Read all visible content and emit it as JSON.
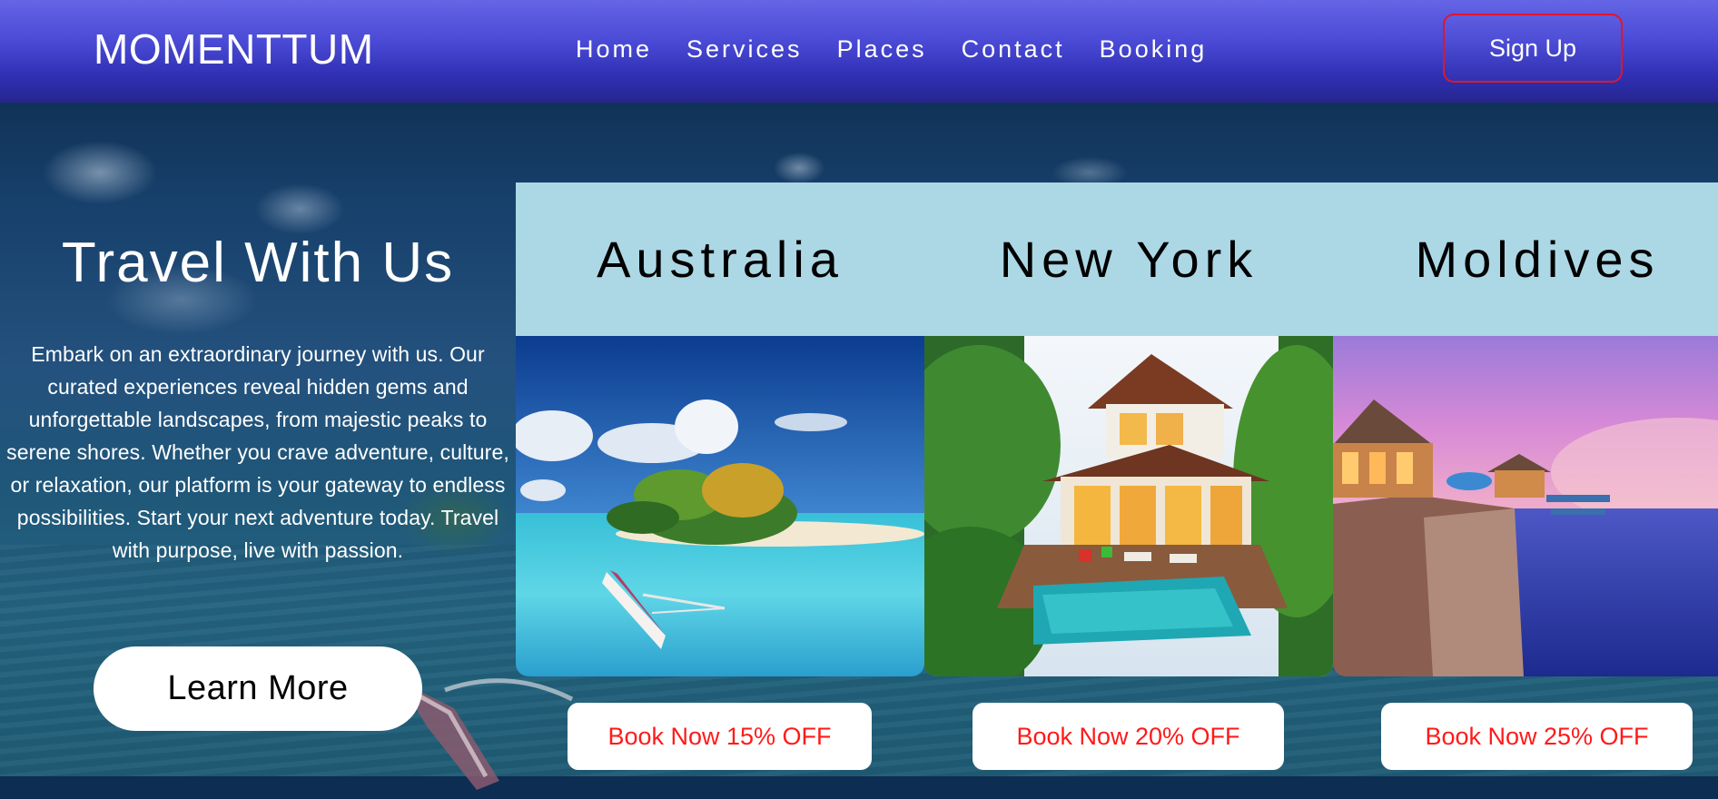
{
  "header": {
    "logo": "MOMENTTUM",
    "nav": [
      "Home",
      "Services",
      "Places",
      "Contact",
      "Booking"
    ],
    "signup_label": "Sign Up"
  },
  "hero": {
    "title": "Travel With Us",
    "description": "Embark on an extraordinary journey with us. Our curated experiences reveal hidden gems and unforgettable landscapes, from majestic peaks to serene shores. Whether you crave adventure, culture, or relaxation, our platform is your gateway to endless possibilities. Start your next adventure today. Travel with purpose, live with passion.",
    "cta_label": "Learn More"
  },
  "destinations": [
    {
      "name": "Australia",
      "book_label": "Book Now 15% OFF"
    },
    {
      "name": "New York",
      "book_label": "Book Now 20% OFF"
    },
    {
      "name": "Moldives",
      "book_label": "Book Now 25% OFF"
    }
  ],
  "colors": {
    "header_top": "#6565e6",
    "header_bottom": "#26268f",
    "signup_border": "#e0162b",
    "card_head_bg": "#acd8e6",
    "book_text": "#ff1a1a"
  }
}
